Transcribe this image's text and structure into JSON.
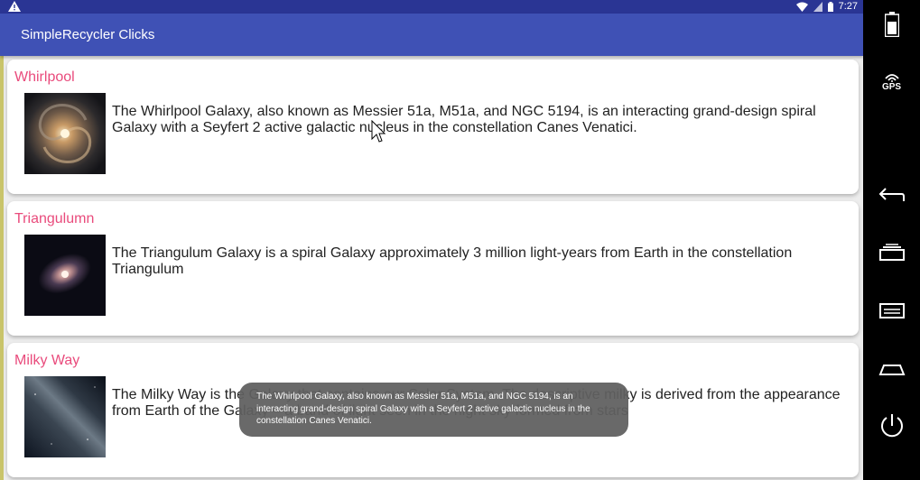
{
  "status_bar": {
    "time": "7:27",
    "icons": [
      "warning-icon",
      "wifi-icon",
      "signal-icon",
      "battery-icon"
    ]
  },
  "app_bar": {
    "title": "SimpleRecycler Clicks"
  },
  "cards": [
    {
      "title": "Whirlpool",
      "description": "The Whirlpool Galaxy, also known as Messier 51a, M51a, and NGC 5194, is an interacting grand-design spiral Galaxy with a Seyfert 2 active galactic nucleus in the constellation Canes Venatici."
    },
    {
      "title": "Triangulumn",
      "description": "The Triangulum Galaxy is a spiral Galaxy approximately 3 million light-years from Earth in the constellation Triangulum"
    },
    {
      "title": "Milky Way",
      "description": "The Milky Way is the Galaxy that contains our Solar System. The descriptive milky is derived from the appearance from Earth of the Galaxy – a band of light seen in the night sky formed from stars"
    }
  ],
  "toast": {
    "text": "The Whirlpool Galaxy, also known as Messier 51a, M51a, and NGC 5194, is an interacting grand-design spiral Galaxy with a Seyfert 2 active galactic nucleus in the constellation Canes Venatici."
  },
  "side_nav": {
    "gps_label": "GPS",
    "buttons": [
      "battery-icon",
      "gps-icon",
      "back-icon",
      "recent-apps-icon",
      "menu-icon",
      "home-icon",
      "power-icon"
    ]
  },
  "colors": {
    "status_bar": "#2a3594",
    "app_bar": "#3f51b5",
    "card_title": "#e94b7c",
    "toast_bg": "#606060"
  }
}
